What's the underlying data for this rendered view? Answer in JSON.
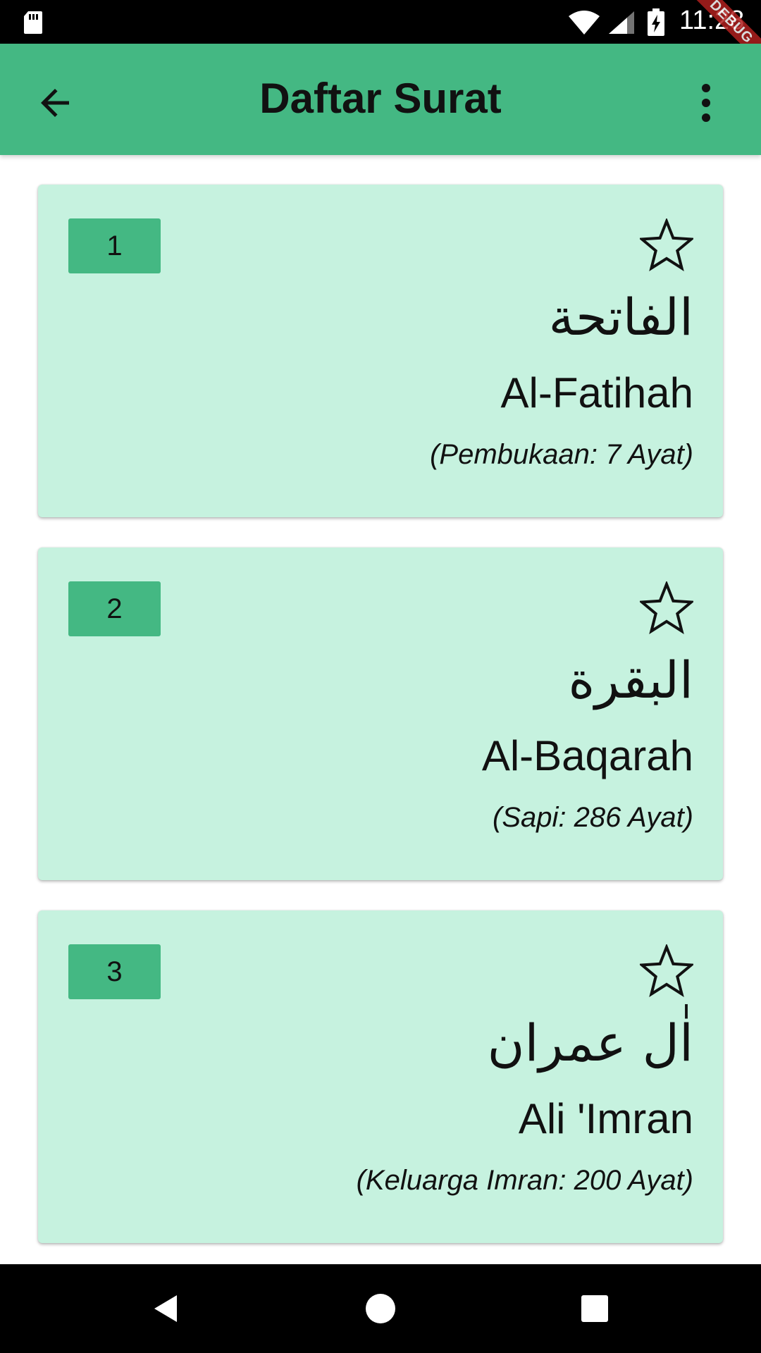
{
  "status_bar": {
    "time": "11:28",
    "icons": [
      "sd-card-icon",
      "wifi-icon",
      "cell-signal-icon",
      "battery-charging-icon"
    ],
    "ribbon": "DEBUG"
  },
  "app_bar": {
    "title": "Daftar Surat",
    "leading_icon": "arrow-back-icon",
    "trailing_icon": "more-vert-icon",
    "color": "#44b883"
  },
  "surah_list": {
    "items": [
      {
        "number": "1",
        "arabic": "الفاتحة",
        "latin": "Al-Fatihah",
        "meaning": "(Pembukaan: 7 Ayat)",
        "favorite": false
      },
      {
        "number": "2",
        "arabic": "البقرة",
        "latin": "Al-Baqarah",
        "meaning": "(Sapi: 286 Ayat)",
        "favorite": false
      },
      {
        "number": "3",
        "arabic": "اٰل عمران",
        "latin": "Ali 'Imran",
        "meaning": "(Keluarga Imran: 200 Ayat)",
        "favorite": false
      }
    ],
    "card_color": "#c6f2df",
    "badge_color": "#44b883"
  },
  "nav_bar": {
    "icons": [
      "nav-back-icon",
      "nav-home-icon",
      "nav-recents-icon"
    ]
  }
}
